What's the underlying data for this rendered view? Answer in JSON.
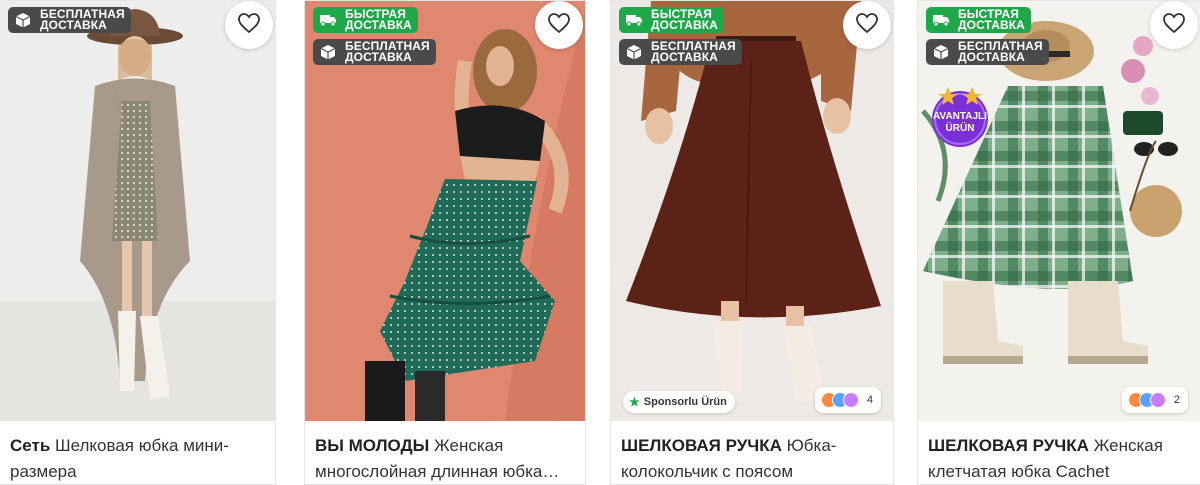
{
  "products": [
    {
      "brand": "Сеть",
      "name_line1": "Шелковая юбка мини-",
      "name_line2": "размера",
      "badges": [
        {
          "icon": "box-icon",
          "line1": "БЕСПЛАТНАЯ",
          "line2": "ДОСТАВКА",
          "color": "#4a4a4a"
        }
      ]
    },
    {
      "brand": "ВЫ МОЛОДЫ",
      "name_line1": "Женская",
      "name_line2": "многослойная длинная юбка…",
      "badges": [
        {
          "icon": "truck-icon",
          "line1": "БЫСТРАЯ",
          "line2": "ДОСТАВКА",
          "color": "#1fa84a"
        },
        {
          "icon": "box-icon",
          "line1": "БЕСПЛАТНАЯ",
          "line2": "ДОСТАВКА",
          "color": "#4a4a4a"
        }
      ]
    },
    {
      "brand": "ШЕЛКОВАЯ РУЧКА",
      "name_line1": "Юбка-",
      "name_line2": "колокольчик с поясом",
      "badges": [
        {
          "icon": "truck-icon",
          "line1": "БЫСТРАЯ",
          "line2": "ДОСТАВКА",
          "color": "#1fa84a"
        },
        {
          "icon": "box-icon",
          "line1": "БЕСПЛАТНАЯ",
          "line2": "ДОСТАВКА",
          "color": "#4a4a4a"
        }
      ],
      "sponsor": "Sponsorlu Ürün",
      "color_count": "4"
    },
    {
      "brand": "ШЕЛКОВАЯ РУЧКА",
      "name_line1": "Женская",
      "name_line2": "клетчатая юбка Cachet",
      "badges": [
        {
          "icon": "truck-icon",
          "line1": "БЫСТРАЯ",
          "line2": "ДОСТАВКА",
          "color": "#1fa84a"
        },
        {
          "icon": "box-icon",
          "line1": "БЕСПЛАТНАЯ",
          "line2": "ДОСТАВКА",
          "color": "#4a4a4a"
        }
      ],
      "avantaj_line1": "AVANTAJLI",
      "avantaj_line2": "ÜRÜN",
      "color_count": "2"
    }
  ],
  "colors": {
    "fast_delivery": "#1fa84a",
    "free_delivery": "#4a4a4a",
    "avantaj_badge": "#7b2fd6"
  }
}
